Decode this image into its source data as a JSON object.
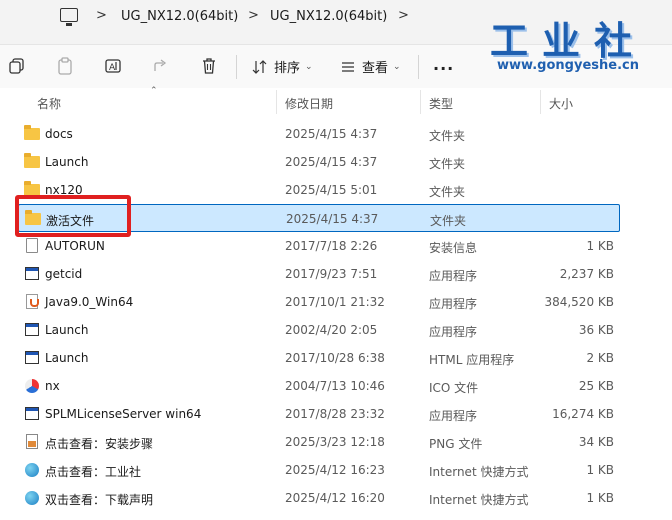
{
  "breadcrumb": {
    "items": [
      "UG_NX12.0(64bit)",
      "UG_NX12.0(64bit)"
    ],
    "separator": ">"
  },
  "watermark": {
    "chinese": "工业社",
    "url": "www.gongyeshe.cn"
  },
  "toolbar": {
    "sort_label": "排序",
    "view_label": "查看",
    "more_label": "···"
  },
  "columns": {
    "name": "名称",
    "modified": "修改日期",
    "type": "类型",
    "size": "大小"
  },
  "files": [
    {
      "name": "docs",
      "modified": "2025/4/15 4:37",
      "type": "文件夹",
      "size": "",
      "icon": "folder-icon"
    },
    {
      "name": "Launch",
      "modified": "2025/4/15 4:37",
      "type": "文件夹",
      "size": "",
      "icon": "folder-icon"
    },
    {
      "name": "nx120",
      "modified": "2025/4/15 5:01",
      "type": "文件夹",
      "size": "",
      "icon": "folder-icon"
    },
    {
      "name": "激活文件",
      "modified": "2025/4/15 4:37",
      "type": "文件夹",
      "size": "",
      "icon": "folder-icon",
      "selected": true
    },
    {
      "name": "AUTORUN",
      "modified": "2017/7/18 2:26",
      "type": "安装信息",
      "size": "1 KB",
      "icon": "setup-info-icon"
    },
    {
      "name": "getcid",
      "modified": "2017/9/23 7:51",
      "type": "应用程序",
      "size": "2,237 KB",
      "icon": "app-icon"
    },
    {
      "name": "Java9.0_Win64",
      "modified": "2017/10/1 21:32",
      "type": "应用程序",
      "size": "384,520 KB",
      "icon": "java-icon"
    },
    {
      "name": "Launch",
      "modified": "2002/4/20 2:05",
      "type": "应用程序",
      "size": "36 KB",
      "icon": "app-icon"
    },
    {
      "name": "Launch",
      "modified": "2017/10/28 6:38",
      "type": "HTML 应用程序",
      "size": "2 KB",
      "icon": "html-app-icon"
    },
    {
      "name": "nx",
      "modified": "2004/7/13 10:46",
      "type": "ICO 文件",
      "size": "25 KB",
      "icon": "nx-logo-icon"
    },
    {
      "name": "SPLMLicenseServer win64",
      "modified": "2017/8/28 23:32",
      "type": "应用程序",
      "size": "16,274 KB",
      "icon": "app-icon"
    },
    {
      "name": "点击查看：安装步骤",
      "modified": "2025/3/23 12:18",
      "type": "PNG 文件",
      "size": "34 KB",
      "icon": "png-icon"
    },
    {
      "name": "点击查看：工业社",
      "modified": "2025/4/12 16:23",
      "type": "Internet 快捷方式",
      "size": "1 KB",
      "icon": "internet-shortcut-icon"
    },
    {
      "name": "双击查看：下载声明",
      "modified": "2025/4/12 16:20",
      "type": "Internet 快捷方式",
      "size": "1 KB",
      "icon": "internet-shortcut-icon"
    }
  ],
  "colors": {
    "selection_bg": "#cce8ff",
    "selection_border": "#0067c0",
    "highlight_box": "#e02020",
    "folder": "#f7c544"
  }
}
